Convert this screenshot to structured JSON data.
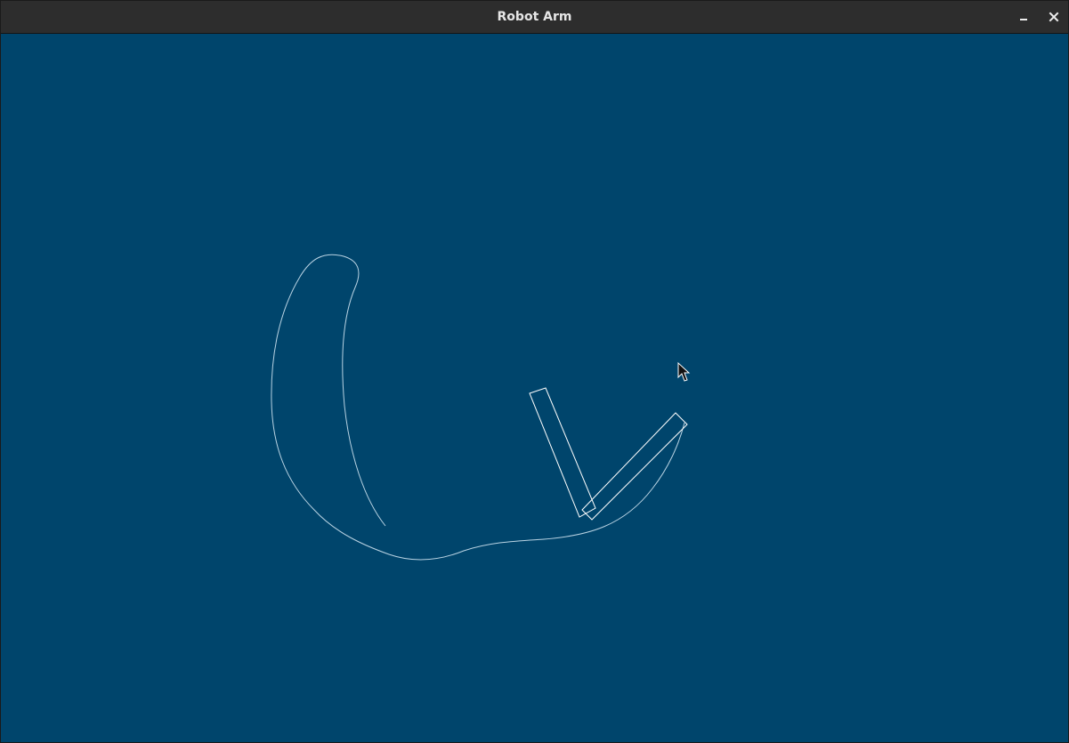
{
  "window": {
    "title": "Robot Arm",
    "background_color": "#00456c",
    "titlebar_color": "#2d2d2d",
    "title_text_color": "#e6e6e6"
  },
  "titlebar_controls": {
    "minimize_icon": "minimize-icon",
    "close_icon": "close-icon"
  },
  "scene": {
    "stroke_color": "#ffffff",
    "trace_color": "#b9d3e3",
    "cursor_icon": "mouse-pointer-icon"
  }
}
